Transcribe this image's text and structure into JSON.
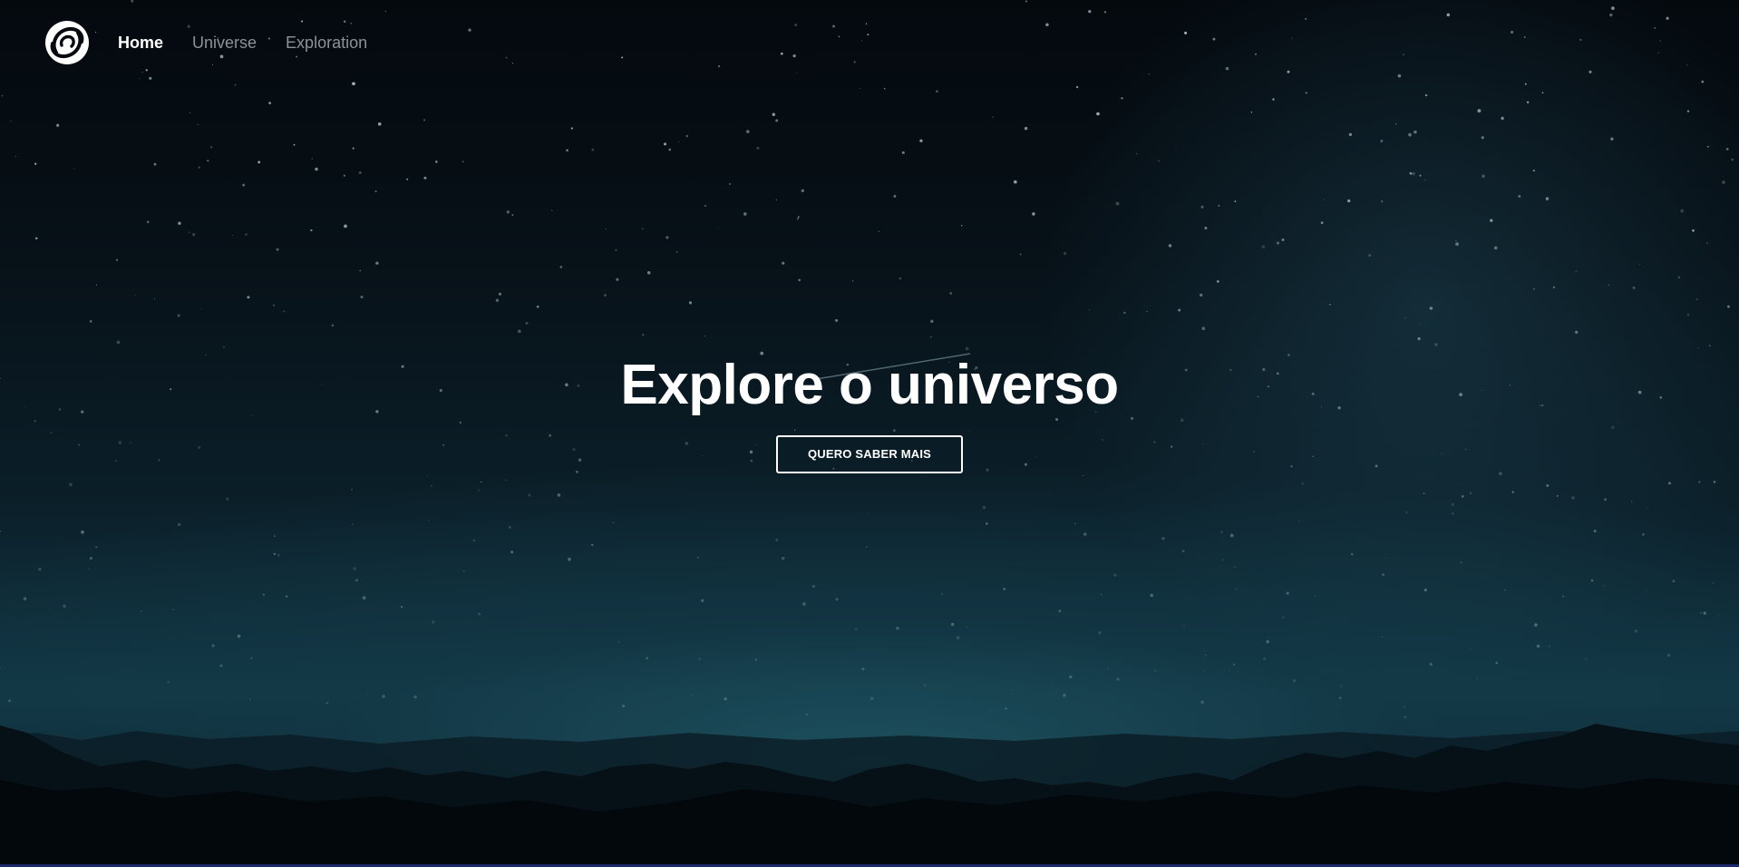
{
  "nav": {
    "logo_icon": "spiral-galaxy-icon",
    "links": [
      {
        "label": "Home",
        "active": true
      },
      {
        "label": "Universe",
        "active": false
      },
      {
        "label": "Exploration",
        "active": false
      }
    ]
  },
  "hero": {
    "title": "Explore o universo",
    "button_label": "QUERO SABER MAIS"
  },
  "colors": {
    "text_primary": "#ffffff",
    "nav_inactive": "#8b9399",
    "sky_dark": "#04090e",
    "horizon_glow": "#1f5565",
    "mountains": "#03080c"
  }
}
